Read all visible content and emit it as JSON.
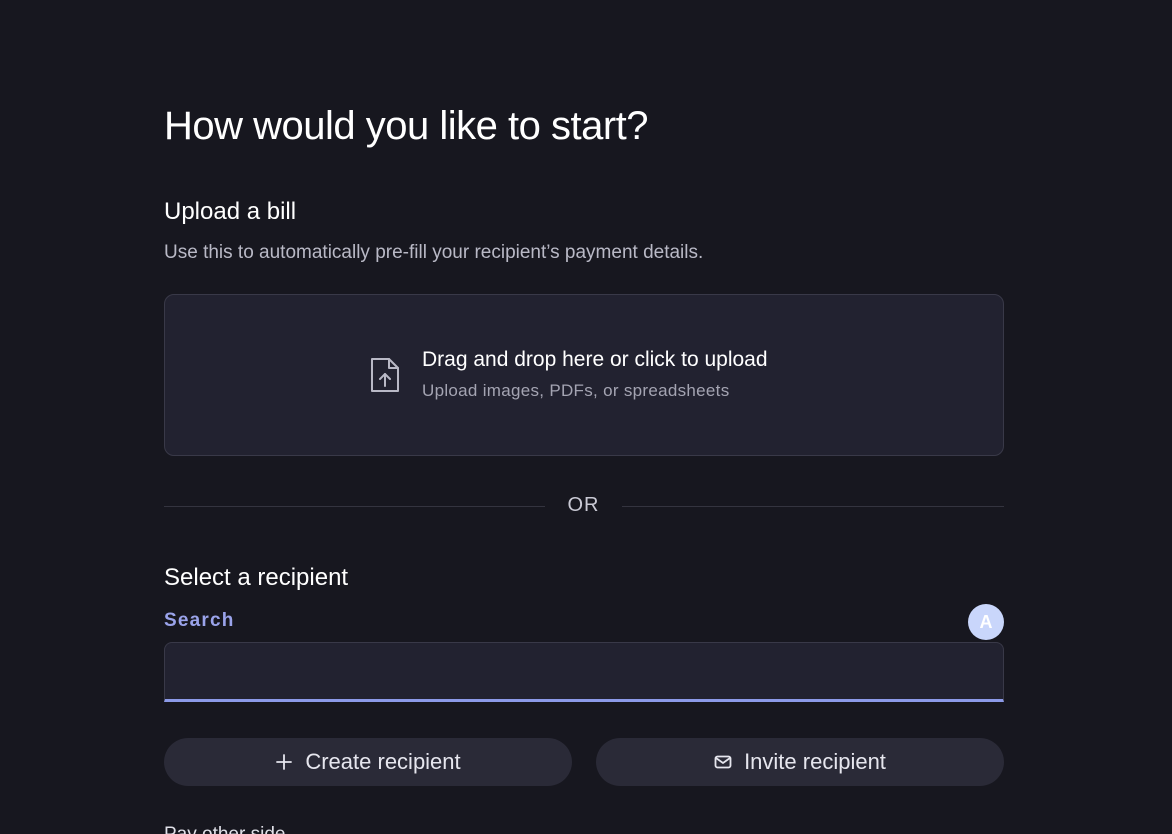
{
  "page": {
    "title": "How would you like to start?"
  },
  "upload": {
    "title": "Upload a bill",
    "description": "Use this to automatically pre-fill your recipient’s payment details.",
    "dropzone_primary": "Drag and drop here or click to upload",
    "dropzone_secondary": "Upload images, PDFs, or spreadsheets",
    "icon": "file-upload-icon"
  },
  "divider": {
    "text": "OR"
  },
  "recipient": {
    "title": "Select a recipient",
    "search_label": "Search",
    "search_value": "",
    "search_placeholder": "",
    "avatar_letter": "A"
  },
  "actions": {
    "create_label": "Create recipient",
    "create_icon": "plus-icon",
    "invite_label": "Invite recipient",
    "invite_icon": "mail-icon"
  },
  "cutoff": {
    "text": "Pay other side..."
  },
  "colors": {
    "background": "#17171f",
    "surface": "#222230",
    "accent": "#8c9ae8",
    "button": "#2a2a37"
  }
}
